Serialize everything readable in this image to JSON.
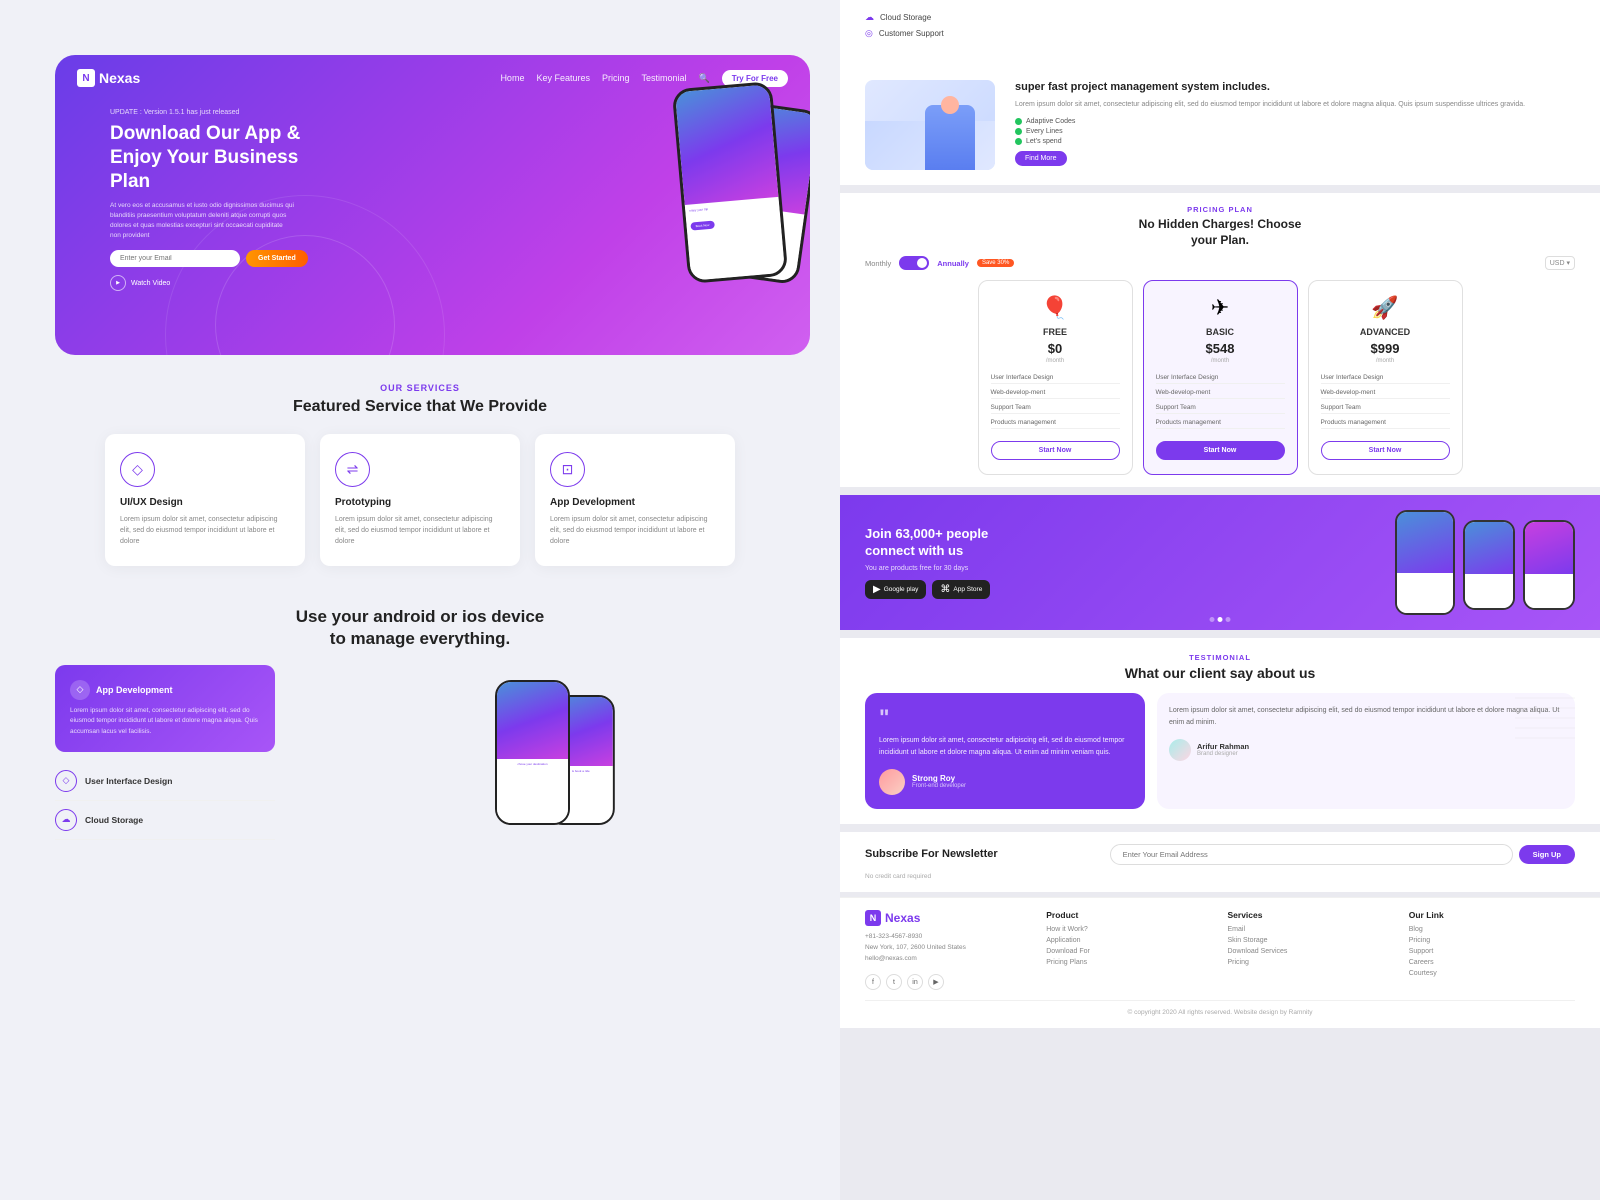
{
  "left": {
    "hero": {
      "logo": "Nexas",
      "logo_letter": "N",
      "nav": {
        "links": [
          "Home",
          "Key Features",
          "Pricing",
          "Testimonial"
        ],
        "try_btn": "Try For Free"
      },
      "update_text": "UPDATE : Version 1.5.1 has just released",
      "title": "Download Our App & Enjoy Your Business Plan",
      "description": "At vero eos et accusamus et iusto odio dignissimos ducimus qui blanditiis praesentium voluptatum deleniti atque corrupti quos dolores et quas molestias excepturi sint occaecati cupiditate non provident",
      "email_placeholder": "Enter your Email",
      "get_started": "Get Started",
      "watch_video": "Watch Video"
    },
    "services": {
      "label": "OUR SERVICES",
      "title": "Featured Service that We Provide",
      "cards": [
        {
          "name": "UI/UX Design",
          "icon": "◇",
          "desc": "Lorem ipsum dolor sit amet, consectetur adipiscing elit, sed do eiusmod tempor incididunt ut labore et dolore"
        },
        {
          "name": "Prototyping",
          "icon": "⇌",
          "desc": "Lorem ipsum dolor sit amet, consectetur adipiscing elit, sed do eiusmod tempor incididunt ut labore et dolore"
        },
        {
          "name": "App Development",
          "icon": "⊡",
          "desc": "Lorem ipsum dolor sit amet, consectetur adipiscing elit, sed do eiusmod tempor incididunt ut labore et dolore"
        }
      ]
    },
    "device": {
      "title": "Use your android or ios device\nto manage everything.",
      "features": [
        {
          "name": "App Development",
          "icon": "◇"
        },
        {
          "name": "User Interface Design",
          "icon": "◇"
        },
        {
          "name": "Cloud Storage",
          "icon": "☁"
        }
      ]
    }
  },
  "right": {
    "top_strip": {
      "items": [
        {
          "icon": "☁",
          "text": "Cloud Storage"
        },
        {
          "icon": "◎",
          "text": "Customer Support"
        }
      ]
    },
    "project": {
      "label": "",
      "title": "super fast project management system includes.",
      "desc": "Lorem ipsum dolor sit amet, consectetur adipiscing elit, sed do eiusmod tempor incididunt ut labore et dolore magna aliqua. Quis ipsum suspendisse ultrices gravida.",
      "checklist": [
        "Adaptive Codes",
        "Every Lines",
        "Let's spend"
      ],
      "find_btn": "Find More"
    },
    "pricing": {
      "label": "PRICING PLAN",
      "title": "No Hidden Charges! Choose\nyour Plan.",
      "toggle_monthly": "Monthly",
      "toggle_annually": "Annually",
      "save_badge": "Save 30%",
      "currency": "USD ▾",
      "plans": [
        {
          "name": "FREE",
          "icon": "🎈",
          "price": "$0",
          "period": "/month",
          "features": [
            "User Interface Design",
            "Web-develop-ment",
            "Support Team",
            "Products management"
          ],
          "btn": "Start Now",
          "featured": false
        },
        {
          "name": "BASIC",
          "icon": "✈",
          "price": "$548",
          "period": "/month",
          "features": [
            "User Interface Design",
            "Web-develop-ment",
            "Support Team",
            "Products management"
          ],
          "btn": "Start Now",
          "featured": true
        },
        {
          "name": "ADVANCED",
          "icon": "🚀",
          "price": "$999",
          "period": "/month",
          "features": [
            "User Interface Design",
            "Web-develop-ment",
            "Support Team",
            "Products management"
          ],
          "btn": "Start Now",
          "featured": false
        }
      ]
    },
    "app_download": {
      "title": "Join 63,000+ people\nconnect with us",
      "sub": "You are products free for 30 days",
      "btn_google": "Google play",
      "btn_apple": "App Store"
    },
    "testimonial": {
      "label": "TESTIMONIAL",
      "title": "What our client say about us",
      "main_quote": "\"",
      "main_text": "Lorem ipsum dolor sit amet, consectetur adipiscing elit, sed do eiusmod tempor incididunt ut labore et dolore magna aliqua. Ut enim ad minim veniam quis.",
      "main_author": "Strong Roy",
      "main_role": "Front-end developer",
      "side_text": "Lorem ipsum dolor sit amet, consectetur adipiscing elit, sed do eiusmod tempor incididunt ut labore et dolore magna aliqua. Ut enim ad minim.",
      "side_author": "Arifur Rahman",
      "side_role": "Brand designer"
    },
    "newsletter": {
      "title": "Subscribe For Newsletter",
      "input_placeholder": "Enter Your Email Address",
      "btn_label": "Sign Up",
      "sub_text": "No credit card required"
    },
    "footer": {
      "logo": "Nexas",
      "logo_letter": "N",
      "phone": "+81-323-4567-8930",
      "address": "New York, 107, 2600 United States",
      "email": "hello@nexas.com",
      "social": [
        "f",
        "t",
        "in",
        "yt"
      ],
      "columns": [
        {
          "title": "Product",
          "links": [
            "How it Work?",
            "Application",
            "Download For",
            "Pricing Plans"
          ]
        },
        {
          "title": "Services",
          "links": [
            "Email",
            "Skin Storage",
            "Download Services",
            "Pricing"
          ]
        },
        {
          "title": "Our Link",
          "links": [
            "Blog",
            "Pricing",
            "Support",
            "Careers",
            "Courtesy"
          ]
        }
      ],
      "copyright": "© copyright 2020 All rights reserved.",
      "credit": "Website design by Ramnity"
    }
  }
}
